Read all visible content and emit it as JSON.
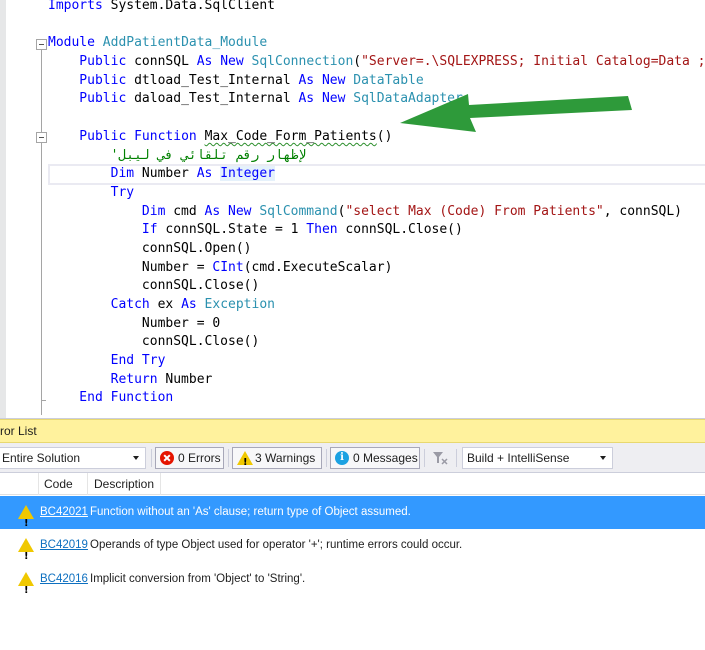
{
  "editor": {
    "lines": [
      [
        {
          "t": "Imports",
          "c": "kw"
        },
        {
          "t": " System.Data.SqlClient"
        }
      ],
      [],
      [
        {
          "t": "Module",
          "c": "kw"
        },
        {
          "t": " "
        },
        {
          "t": "AddPatientData_Module",
          "c": "ty"
        }
      ],
      [
        {
          "t": "    Public",
          "c": "kw"
        },
        {
          "t": " connSQL "
        },
        {
          "t": "As",
          "c": "kw"
        },
        {
          "t": " "
        },
        {
          "t": "New",
          "c": "kw"
        },
        {
          "t": " "
        },
        {
          "t": "SqlConnection",
          "c": "ty"
        },
        {
          "t": "("
        },
        {
          "t": "\"Server=.\\SQLEXPRESS; Initial Catalog=Data ;",
          "c": "st"
        }
      ],
      [
        {
          "t": "    Public",
          "c": "kw"
        },
        {
          "t": " dtload_Test_Internal "
        },
        {
          "t": "As",
          "c": "kw"
        },
        {
          "t": " "
        },
        {
          "t": "New",
          "c": "kw"
        },
        {
          "t": " "
        },
        {
          "t": "DataTable",
          "c": "ty"
        }
      ],
      [
        {
          "t": "    Public",
          "c": "kw"
        },
        {
          "t": " daload_Test_Internal "
        },
        {
          "t": "As",
          "c": "kw"
        },
        {
          "t": " "
        },
        {
          "t": "New",
          "c": "kw"
        },
        {
          "t": " "
        },
        {
          "t": "SqlDataAdapter",
          "c": "ty"
        }
      ],
      [],
      [
        {
          "t": "    Public",
          "c": "kw"
        },
        {
          "t": " "
        },
        {
          "t": "Function",
          "c": "kw"
        },
        {
          "t": " "
        },
        {
          "t": "Max_Code_Form_Patients",
          "c": "squig"
        },
        {
          "t": "()"
        }
      ],
      [
        {
          "t": "        'لإظهار رقم تلقائي في ليبل",
          "c": "cm"
        }
      ],
      [
        {
          "t": "        Dim",
          "c": "kw"
        },
        {
          "t": " Number "
        },
        {
          "t": "As",
          "c": "kw"
        },
        {
          "t": " "
        },
        {
          "t": "Integer",
          "c": "kw hl"
        }
      ],
      [
        {
          "t": "        Try",
          "c": "kw"
        }
      ],
      [
        {
          "t": "            Dim",
          "c": "kw"
        },
        {
          "t": " cmd "
        },
        {
          "t": "As",
          "c": "kw"
        },
        {
          "t": " "
        },
        {
          "t": "New",
          "c": "kw"
        },
        {
          "t": " "
        },
        {
          "t": "SqlCommand",
          "c": "ty"
        },
        {
          "t": "("
        },
        {
          "t": "\"select Max (Code) From Patients\"",
          "c": "st"
        },
        {
          "t": ", connSQL)"
        }
      ],
      [
        {
          "t": "            If",
          "c": "kw"
        },
        {
          "t": " connSQL.State = 1 "
        },
        {
          "t": "Then",
          "c": "kw"
        },
        {
          "t": " connSQL.Close()"
        }
      ],
      [
        {
          "t": "            connSQL.Open()"
        }
      ],
      [
        {
          "t": "            Number = "
        },
        {
          "t": "CInt",
          "c": "kw"
        },
        {
          "t": "(cmd.ExecuteScalar)"
        }
      ],
      [
        {
          "t": "            connSQL.Close()"
        }
      ],
      [
        {
          "t": "        Catch",
          "c": "kw"
        },
        {
          "t": " ex "
        },
        {
          "t": "As",
          "c": "kw"
        },
        {
          "t": " "
        },
        {
          "t": "Exception",
          "c": "ty"
        }
      ],
      [
        {
          "t": "            Number = 0"
        }
      ],
      [
        {
          "t": "            connSQL.Close()"
        }
      ],
      [
        {
          "t": "        End Try",
          "c": "kw"
        }
      ],
      [
        {
          "t": "        Return",
          "c": "kw"
        },
        {
          "t": " Number"
        }
      ],
      [
        {
          "t": "    End Function",
          "c": "kw"
        }
      ]
    ]
  },
  "error_list": {
    "title": "ror List",
    "scope": "Entire Solution",
    "errors_label": "0 Errors",
    "warnings_label": "3 Warnings",
    "messages_label": "0 Messages",
    "build_option": "Build + IntelliSense",
    "columns": {
      "code": "Code",
      "description": "Description"
    },
    "rows": [
      {
        "code": "BC42021",
        "description": "Function without an 'As' clause; return type of Object assumed.",
        "selected": true
      },
      {
        "code": "BC42019",
        "description": "Operands of type Object used for operator '+'; runtime errors could occur.",
        "selected": false
      },
      {
        "code": "BC42016",
        "description": "Implicit conversion from 'Object' to 'String'.",
        "selected": false
      }
    ]
  },
  "colors": {
    "keyword": "#0000ff",
    "type": "#2b91af",
    "string": "#a31515",
    "comment": "#008000",
    "selection": "#3399ff",
    "titlebar": "#fff29d",
    "annotation_arrow": "#2e9a3a"
  },
  "icons": [
    "outline-collapse-icon",
    "error-icon",
    "warning-icon",
    "info-icon",
    "filter-icon",
    "dropdown-arrow-icon",
    "annotation-arrow"
  ]
}
